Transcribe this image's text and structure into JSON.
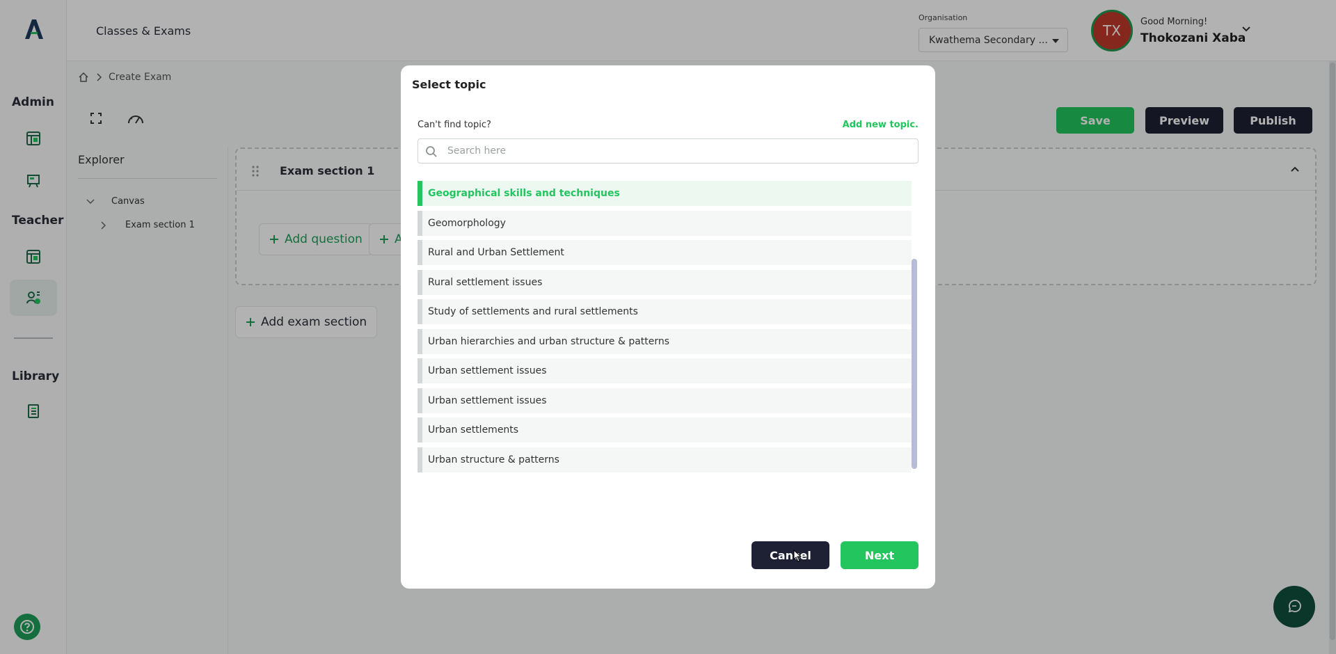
{
  "header": {
    "title": "Classes & Exams",
    "org_label": "Organisation",
    "org_value": "Kwathema Secondary ...",
    "avatar_initials": "TX",
    "greeting": "Good Morning!",
    "user_name": "Thokozani Xaba"
  },
  "sidebar": {
    "sections": [
      "Admin",
      "Teacher",
      "Library"
    ]
  },
  "breadcrumb": {
    "current": "Create Exam"
  },
  "toolbar": {
    "save": "Save",
    "preview": "Preview",
    "publish": "Publish"
  },
  "explorer": {
    "title": "Explorer",
    "canvas": "Canvas",
    "section": "Exam section 1"
  },
  "canvas": {
    "section_title": "Exam section 1",
    "add_question": "Add question",
    "add_second_partial": "A",
    "add_exam_section": "Add exam section"
  },
  "modal": {
    "title": "Select topic",
    "cant_find": "Can't find topic?",
    "add_new": "Add new topic.",
    "search_placeholder": "Search here",
    "topics": [
      "Geographical skills and techniques",
      "Geomorphology",
      "Rural and Urban Settlement",
      "Rural settlement issues",
      "Study of settlements and rural settlements",
      "Urban hierarchies and urban structure & patterns",
      "Urban settlement issues",
      "Urban settlement issues",
      "Urban settlements",
      "Urban structure & patterns"
    ],
    "selected_topic": "Geographical skills and techniques",
    "cancel": "Cancel",
    "next": "Next"
  },
  "colors": {
    "accent_green": "#22c55e",
    "dark_button": "#1d2133",
    "avatar_red": "#c0392b"
  }
}
